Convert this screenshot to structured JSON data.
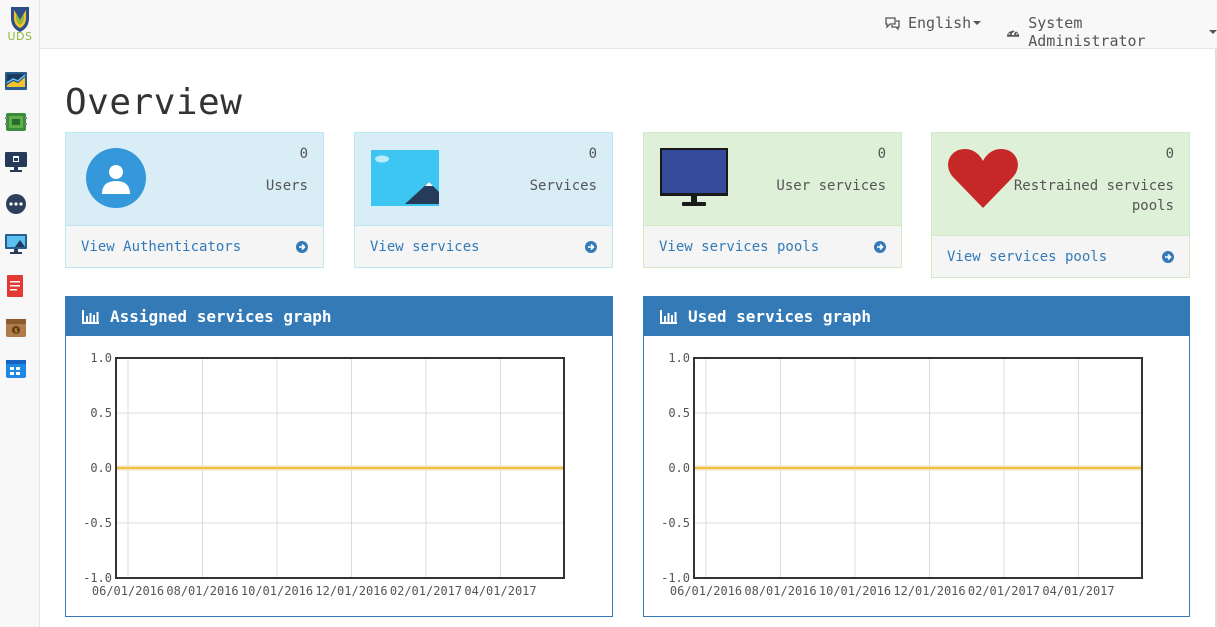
{
  "sidebar": {
    "logo_text": "UDS",
    "items": [
      {
        "icon": "dashboard-icon"
      },
      {
        "icon": "services-icon"
      },
      {
        "icon": "authenticators-icon"
      },
      {
        "icon": "more-icon"
      },
      {
        "icon": "pools-icon"
      },
      {
        "icon": "reports-icon"
      },
      {
        "icon": "gallery-icon"
      },
      {
        "icon": "calendar-icon"
      }
    ]
  },
  "topbar": {
    "language": "English",
    "user": "System Administrator"
  },
  "page_title": "Overview",
  "stats": [
    {
      "value": "0",
      "label": "Users",
      "link": "View Authenticators"
    },
    {
      "value": "0",
      "label": "Services",
      "link": "View services"
    },
    {
      "value": "0",
      "label": "User services",
      "link": "View services pools"
    },
    {
      "value": "0",
      "label_1": "Restrained services",
      "label_2": "pools",
      "link": "View services pools"
    }
  ],
  "graphs": {
    "assigned_title": "Assigned services graph",
    "used_title": "Used services graph"
  },
  "chart_data": [
    {
      "type": "line",
      "title": "Assigned services graph",
      "x_ticks": [
        "06/01/2016",
        "08/01/2016",
        "10/01/2016",
        "12/01/2016",
        "02/01/2017",
        "04/01/2017"
      ],
      "y_ticks": [
        "1.0",
        "0.5",
        "0.0",
        "-0.5",
        "-1.0"
      ],
      "ylim": [
        -1.0,
        1.0
      ],
      "series": [
        {
          "values": [
            0,
            0,
            0,
            0,
            0,
            0
          ],
          "color": "#edc240"
        }
      ],
      "grid": true
    },
    {
      "type": "line",
      "title": "Used services graph",
      "x_ticks": [
        "06/01/2016",
        "08/01/2016",
        "10/01/2016",
        "12/01/2016",
        "02/01/2017",
        "04/01/2017"
      ],
      "y_ticks": [
        "1.0",
        "0.5",
        "0.0",
        "-0.5",
        "-1.0"
      ],
      "ylim": [
        -1.0,
        1.0
      ],
      "series": [
        {
          "values": [
            0,
            0,
            0,
            0,
            0,
            0
          ],
          "color": "#edc240"
        }
      ],
      "grid": true
    }
  ],
  "colors": {
    "primary": "#337ab7",
    "info_bg": "#d9edf7",
    "success_bg": "#dff0d8",
    "heart": "#c62828",
    "series": "#edc240"
  }
}
